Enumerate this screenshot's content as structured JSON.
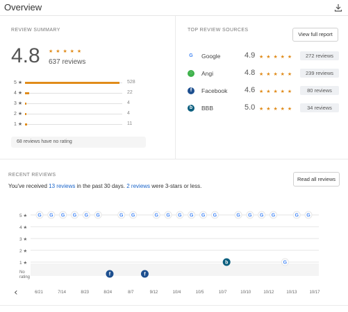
{
  "header": {
    "title": "Overview",
    "download_icon": "download-icon"
  },
  "summary": {
    "label": "REVIEW SUMMARY",
    "rating": "4.8",
    "review_count": "637 reviews",
    "distribution": [
      {
        "label": "5 ★",
        "count": "528",
        "value": 528
      },
      {
        "label": "4 ★",
        "count": "22",
        "value": 22
      },
      {
        "label": "3 ★",
        "count": "4",
        "value": 4
      },
      {
        "label": "2 ★",
        "count": "4",
        "value": 4
      },
      {
        "label": "1 ★",
        "count": "11",
        "value": 11
      }
    ],
    "no_rating_text": "68 reviews have no rating"
  },
  "sources": {
    "label": "TOP REVIEW SOURCES",
    "view_button": "View full report",
    "items": [
      {
        "name": "Google",
        "score": "4.9",
        "reviews": "272 reviews",
        "icon": "google-icon",
        "color": "#4285f4",
        "bg": "#ffffff",
        "glyph": "G"
      },
      {
        "name": "Angi",
        "score": "4.8",
        "reviews": "239 reviews",
        "icon": "angi-icon",
        "color": "#ffffff",
        "bg": "#3db14a",
        "glyph": "◌"
      },
      {
        "name": "Facebook",
        "score": "4.6",
        "reviews": "80 reviews",
        "icon": "facebook-icon",
        "color": "#ffffff",
        "bg": "#1d4f8f",
        "glyph": "f"
      },
      {
        "name": "BBB",
        "score": "5.0",
        "reviews": "34 reviews",
        "icon": "bbb-icon",
        "color": "#ffffff",
        "bg": "#0b5e7e",
        "glyph": "b"
      }
    ]
  },
  "recent": {
    "label": "RECENT REVIEWS",
    "read_button": "Read all reviews",
    "text_pre": "You've received ",
    "text_link1": "13 reviews",
    "text_mid": " in the past 30 days. ",
    "text_link2": "2 reviews",
    "text_post": " were 3-stars or less."
  },
  "chart_data": {
    "type": "scatter",
    "y_categories": [
      "5 ★",
      "4 ★",
      "3 ★",
      "2 ★",
      "1 ★",
      "No rating"
    ],
    "x_tick_labels": [
      "6/21",
      "7/14",
      "8/23",
      "8/24",
      "8/7",
      "9/12",
      "10/4",
      "10/5",
      "10/7",
      "10/10",
      "10/12",
      "10/13",
      "10/17"
    ],
    "nav_prev": "‹",
    "points": [
      {
        "x": 0,
        "y": "5 ★",
        "source": "google"
      },
      {
        "x": 1,
        "y": "5 ★",
        "source": "google"
      },
      {
        "x": 2,
        "y": "5 ★",
        "source": "google"
      },
      {
        "x": 3,
        "y": "5 ★",
        "source": "google"
      },
      {
        "x": 4,
        "y": "5 ★",
        "source": "google"
      },
      {
        "x": 5,
        "y": "5 ★",
        "source": "google"
      },
      {
        "x": 7,
        "y": "5 ★",
        "source": "google"
      },
      {
        "x": 8,
        "y": "5 ★",
        "source": "google"
      },
      {
        "x": 10,
        "y": "5 ★",
        "source": "google"
      },
      {
        "x": 11,
        "y": "5 ★",
        "source": "google"
      },
      {
        "x": 12,
        "y": "5 ★",
        "source": "google"
      },
      {
        "x": 13,
        "y": "5 ★",
        "source": "google"
      },
      {
        "x": 14,
        "y": "5 ★",
        "source": "google"
      },
      {
        "x": 15,
        "y": "5 ★",
        "source": "google"
      },
      {
        "x": 17,
        "y": "5 ★",
        "source": "google"
      },
      {
        "x": 18,
        "y": "5 ★",
        "source": "google"
      },
      {
        "x": 19,
        "y": "5 ★",
        "source": "google"
      },
      {
        "x": 20,
        "y": "5 ★",
        "source": "google"
      },
      {
        "x": 22,
        "y": "5 ★",
        "source": "google"
      },
      {
        "x": 23,
        "y": "5 ★",
        "source": "google"
      },
      {
        "x": 16,
        "y": "1 ★",
        "source": "bbb"
      },
      {
        "x": 21,
        "y": "1 ★",
        "source": "google"
      },
      {
        "x": 6,
        "y": "No rating",
        "source": "facebook"
      },
      {
        "x": 9,
        "y": "No rating",
        "source": "facebook"
      }
    ]
  }
}
